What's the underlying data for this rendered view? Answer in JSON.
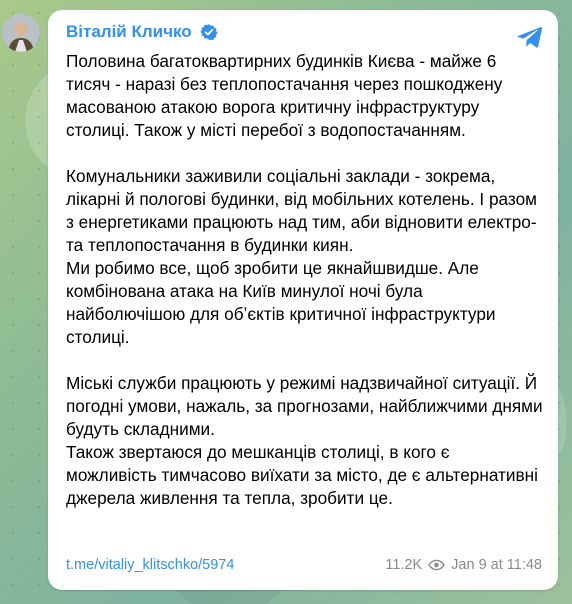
{
  "post": {
    "author": "Віталій Кличко",
    "icons": {
      "verified": "verified-badge-icon",
      "share": "share-telegram-icon",
      "views": "eye-icon"
    },
    "colors": {
      "accent": "#3390ec",
      "meta": "#8a8a8a"
    },
    "paragraphs": [
      "Половина багатоквартирних будинків Києва - майже 6 тисяч - наразі без теплопостачання через пошкоджену масованою атакою ворога критичну інфраструктуру столиці. Також у місті перебої з водопостачанням.",
      "Комунальники заживили соціальні заклади - зокрема, лікарні й пологові будинки, від мобільних котелень. І разом з енергетиками працюють над тим, аби відновити електро- та теплопостачання в будинки киян.\nМи робимо все, щоб зробити це якнайшвидше. Але комбінована атака на Київ минулої ночі була найболючішою для обʼєктів критичної інфраструктури столиці.",
      "Міські служби працюють у режимі надзвичайної ситуації. Й погодні умови, нажаль, за прогнозами, найближчими днями будуть складними.\nТакож звертаюся до мешканців столиці, в кого є можливість тимчасово виїхати за місто, де є альтернативні джерела живлення та тепла, зробити це."
    ],
    "link": "t.me/vitaliy_klitschko/5974",
    "views": "11.2K",
    "date": "Jan 9 at 11:48"
  }
}
